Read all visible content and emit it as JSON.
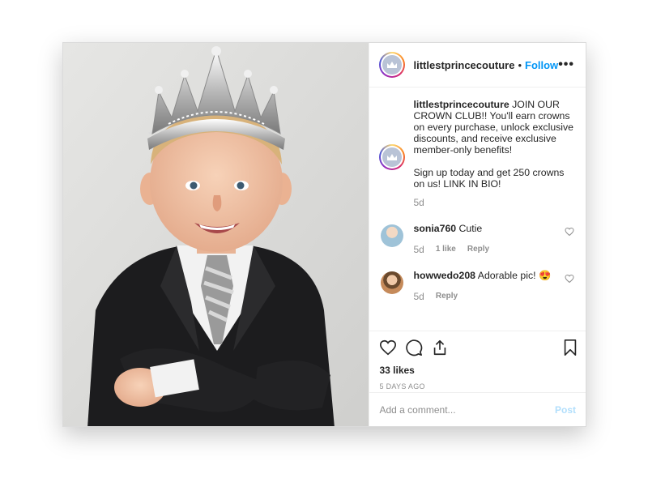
{
  "post": {
    "username": "littlestprincecouture",
    "separator": "•",
    "follow_label": "Follow",
    "more_label": "•••",
    "caption_username": "littlestprincecouture",
    "caption_text": " JOIN OUR CROWN CLUB!! You'll earn crowns on every purchase, unlock exclusive discounts, and receive exclusive member-only benefits!\n\nSign up today and get 250 crowns on us! LINK IN BIO!",
    "caption_time": "5d",
    "likes": "33 likes",
    "posted_ago": "5 DAYS AGO"
  },
  "comments": [
    {
      "username": "sonia760",
      "text": " Cutie",
      "time": "5d",
      "likes": "1 like",
      "reply": "Reply",
      "avatar_color": "#9fc3d8"
    },
    {
      "username": "howwedo208",
      "text": " Adorable pic! 😍",
      "time": "5d",
      "reply": "Reply",
      "avatar_color": "#c58a5a"
    }
  ],
  "add_comment": {
    "placeholder": "Add a comment...",
    "post_label": "Post"
  },
  "icons": [
    "heart-icon",
    "comment-icon",
    "share-icon",
    "bookmark-icon",
    "more-icon",
    "crown-icon"
  ],
  "colors": {
    "accent": "#0095f6",
    "post_disabled": "#b2dffc",
    "muted": "#8e8e8e",
    "text": "#262626"
  }
}
